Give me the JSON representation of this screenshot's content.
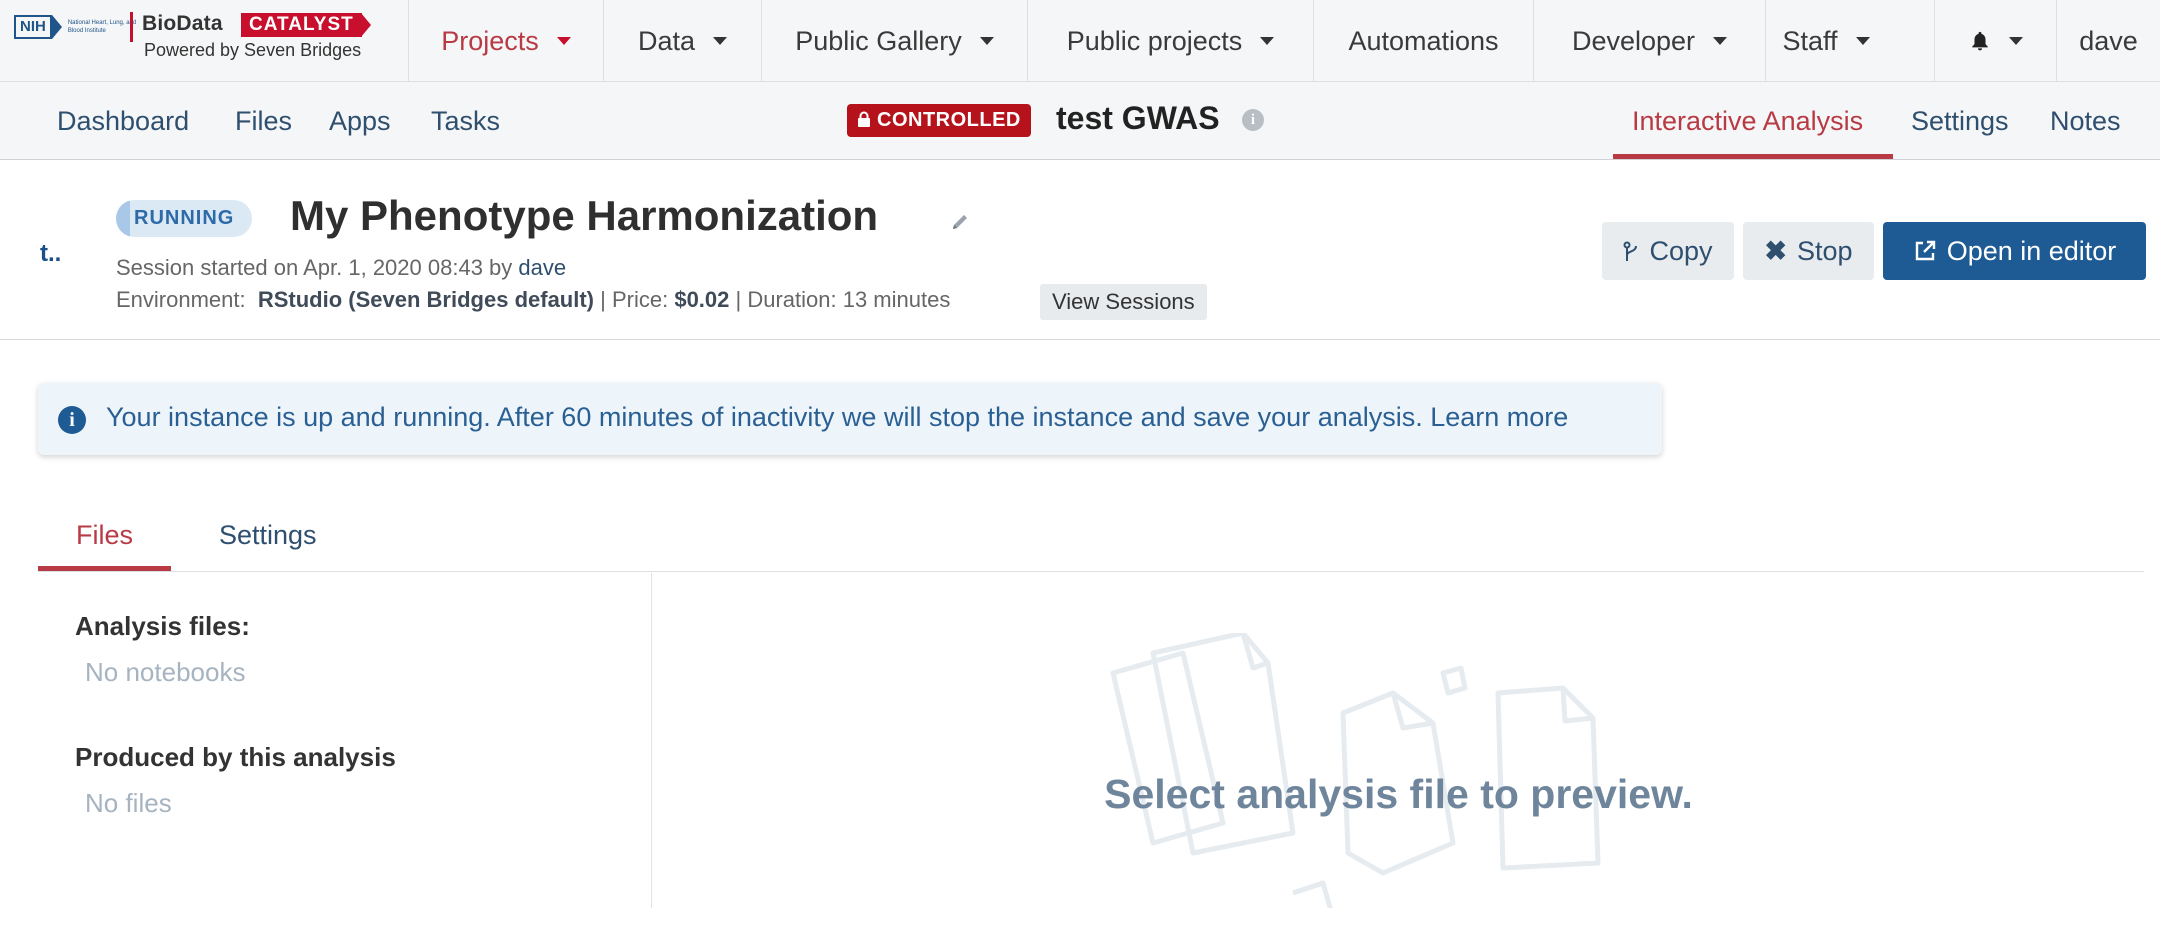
{
  "brand": {
    "nih": "NIH",
    "nih_subtext": "National Heart, Lung, and Blood Institute",
    "biodata": "BioData",
    "catalyst": "CATALYST",
    "powered": "Powered by Seven Bridges"
  },
  "topnav": {
    "projects": "Projects",
    "data": "Data",
    "public_gallery": "Public Gallery",
    "public_projects": "Public projects",
    "automations": "Automations",
    "developer": "Developer",
    "staff": "Staff",
    "user": "dave"
  },
  "subnav": {
    "dashboard": "Dashboard",
    "files": "Files",
    "apps": "Apps",
    "tasks": "Tasks",
    "controlled_label": "CONTROLLED",
    "project_name": "test GWAS",
    "interactive_analysis": "Interactive Analysis",
    "settings": "Settings",
    "notes": "Notes"
  },
  "analysis": {
    "mini_logo": "t..",
    "status": "RUNNING",
    "title": "My Phenotype Harmonization",
    "session_started_label": "Session started on Apr. 1, 2020 08:43 by",
    "session_user": "dave",
    "environment_label": "Environment:",
    "environment_value": "RStudio (Seven Bridges default)",
    "price_label": "| Price:",
    "price_value": "$0.02",
    "duration": "| Duration: 13 minutes",
    "view_sessions": "View Sessions"
  },
  "actions": {
    "copy": "Copy",
    "stop": "Stop",
    "open_in_editor": "Open in editor"
  },
  "banner": {
    "text": "Your instance is up and running. After 60 minutes of inactivity we will stop the instance and save your analysis. Learn more"
  },
  "tabs": {
    "files": "Files",
    "settings": "Settings"
  },
  "panel": {
    "analysis_files_heading": "Analysis files:",
    "analysis_files_empty": "No notebooks",
    "produced_heading": "Produced by this analysis",
    "produced_empty": "No files"
  },
  "preview": {
    "text": "Select analysis file to preview."
  },
  "colors": {
    "accent_red": "#b83a44",
    "controlled_red": "#b5121b",
    "primary_blue": "#1e5a93",
    "banner_bg": "#eef5fa"
  }
}
